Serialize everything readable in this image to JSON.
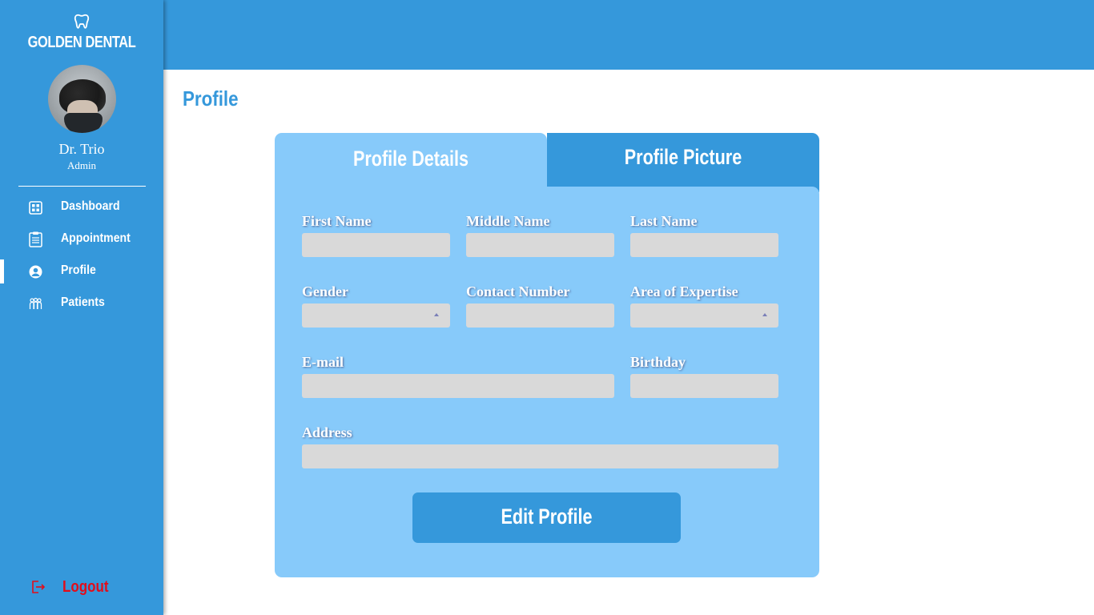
{
  "brand": {
    "name": "GOLDEN DENTAL",
    "logo_icon": "tooth-icon"
  },
  "user": {
    "name": "Dr. Trio",
    "role": "Admin"
  },
  "nav": {
    "items": [
      {
        "label": "Dashboard",
        "icon": "dashboard-grid-icon",
        "active": false
      },
      {
        "label": "Appointment",
        "icon": "clipboard-icon",
        "active": false
      },
      {
        "label": "Profile",
        "icon": "user-circle-icon",
        "active": true
      },
      {
        "label": "Patients",
        "icon": "group-icon",
        "active": false
      }
    ],
    "logout_label": "Logout"
  },
  "page": {
    "title": "Profile"
  },
  "tabs": {
    "details": "Profile Details",
    "picture": "Profile Picture"
  },
  "form": {
    "first_name": {
      "label": "First Name",
      "value": ""
    },
    "middle_name": {
      "label": "Middle Name",
      "value": ""
    },
    "last_name": {
      "label": "Last Name",
      "value": ""
    },
    "gender": {
      "label": "Gender",
      "value": ""
    },
    "contact_number": {
      "label": "Contact Number",
      "value": ""
    },
    "area_of_expertise": {
      "label": "Area of Expertise",
      "value": ""
    },
    "email": {
      "label": "E-mail",
      "value": ""
    },
    "birthday": {
      "label": "Birthday",
      "value": ""
    },
    "address": {
      "label": "Address",
      "value": ""
    },
    "edit_button": "Edit Profile"
  },
  "colors": {
    "primary": "#3598db",
    "card": "#87cafa",
    "input": "#d9d9d9",
    "logout": "#e20d1a"
  }
}
